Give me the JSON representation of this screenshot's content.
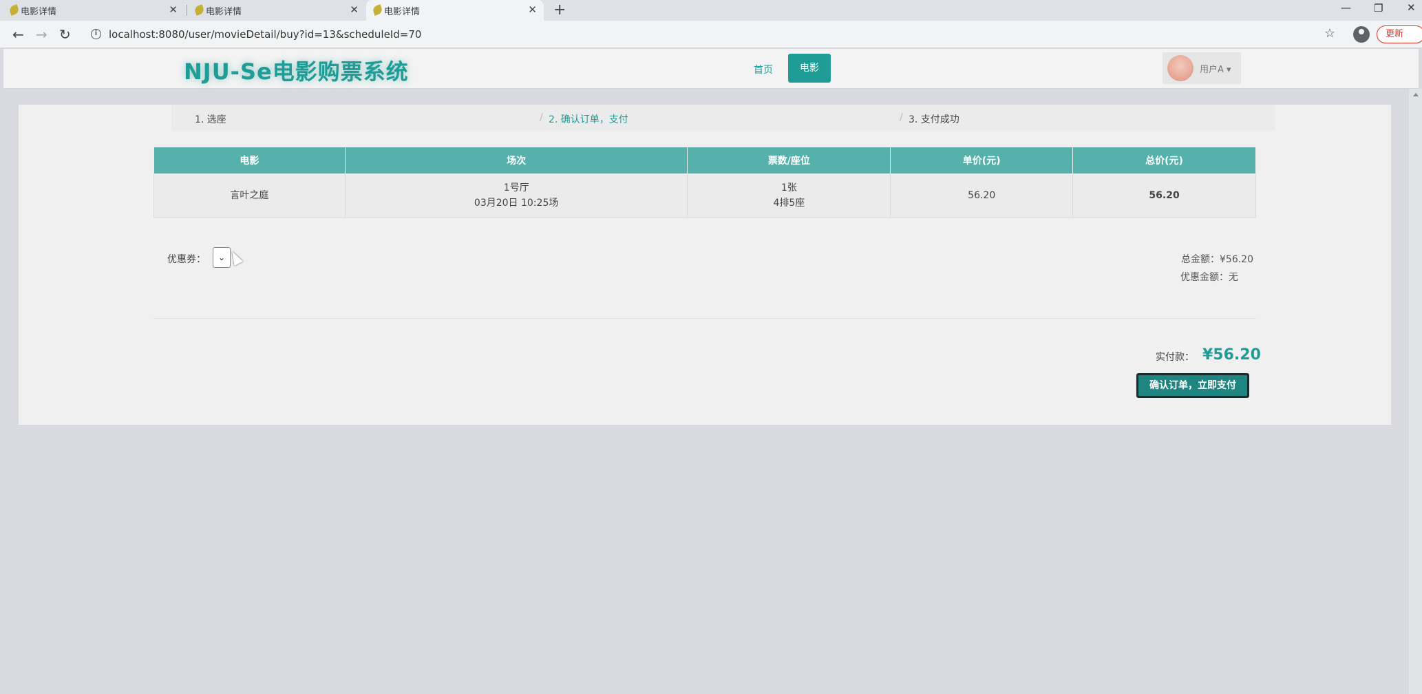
{
  "browser": {
    "tabs": [
      {
        "title": "电影详情",
        "close": "✕"
      },
      {
        "title": "电影详情",
        "close": "✕"
      },
      {
        "title": "电影详情",
        "close": "✕"
      }
    ],
    "new_tab": "+",
    "window_controls": {
      "minimize": "—",
      "restore": "❐",
      "close": "✕"
    },
    "nav": {
      "back": "←",
      "forward": "→",
      "reload": "↻"
    },
    "url": "localhost:8080/user/movieDetail/buy?id=13&scheduleId=70",
    "info_glyph": "i",
    "star": "☆",
    "update_label": "更新"
  },
  "site": {
    "logo": "NJU-Se电影购票系统",
    "nav": {
      "home": "首页",
      "movie": "电影"
    },
    "user": {
      "name": "用户A ▾"
    }
  },
  "steps": [
    {
      "label": "1. 选座"
    },
    {
      "label": "2. 确认订单，支付"
    },
    {
      "label": "3. 支付成功"
    }
  ],
  "step_separator": "/",
  "order_table": {
    "headers": [
      "电影",
      "场次",
      "票数/座位",
      "单价(元)",
      "总价(元)"
    ],
    "row": {
      "movie": "言叶之庭",
      "hall": "1号厅",
      "time": "03月20日 10:25场",
      "ticket_count": "1张",
      "seat": "4排5座",
      "unit_price": "56.20",
      "total_price": "56.20"
    }
  },
  "coupon": {
    "label": "优惠券：",
    "selected": "⌄"
  },
  "summary": {
    "total_label": "总金额：",
    "total_value": "¥56.20",
    "discount_label": "优惠金额：",
    "discount_value": "无"
  },
  "payment": {
    "label": "实付款：",
    "amount": "¥56.20",
    "confirm_button": "确认订单，立即支付"
  },
  "colors": {
    "accent": "#1f9c95",
    "table_header": "#56b1ad",
    "button": "#1f8580"
  }
}
